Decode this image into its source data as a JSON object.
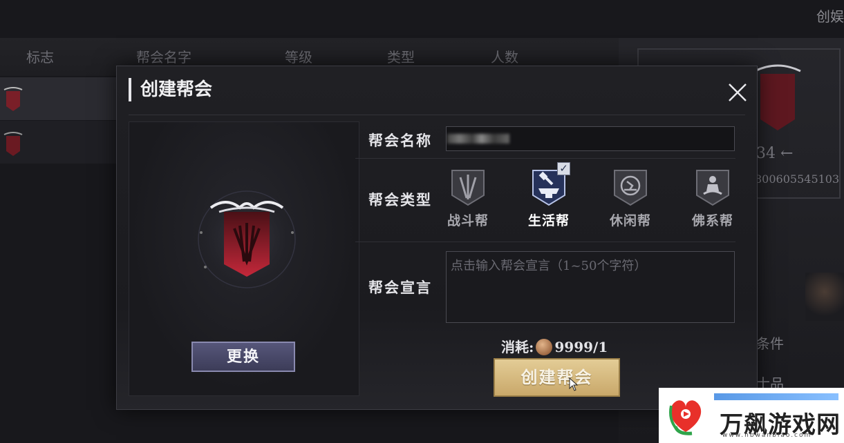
{
  "background": {
    "columns": [
      "标志",
      "帮会名字",
      "等级",
      "类型",
      "人数"
    ],
    "top_right_text": "创娱",
    "right_panel": {
      "number": "34 ←",
      "id": "800605545103",
      "condition_label": "条件",
      "rank_label": "士品"
    }
  },
  "dialog": {
    "title": "创建帮会",
    "change_button": "更换",
    "name_label": "帮会名称",
    "name_value": "",
    "type_label": "帮会类型",
    "types": [
      {
        "label": "战斗帮",
        "icon": "swords-icon",
        "selected": false
      },
      {
        "label": "生活帮",
        "icon": "anvil-hammer-icon",
        "selected": true
      },
      {
        "label": "休闲帮",
        "icon": "relax-icon",
        "selected": false
      },
      {
        "label": "佛系帮",
        "icon": "meditation-icon",
        "selected": false
      }
    ],
    "declaration_label": "帮会宣言",
    "declaration_placeholder": "点击输入帮会宣言（1~50个字符）",
    "cost_label": "消耗:",
    "cost_value": "9999/1",
    "create_button": "创建帮会"
  },
  "watermark": {
    "text": "万飙游戏网",
    "url": "www.hbwanbiao.com"
  }
}
